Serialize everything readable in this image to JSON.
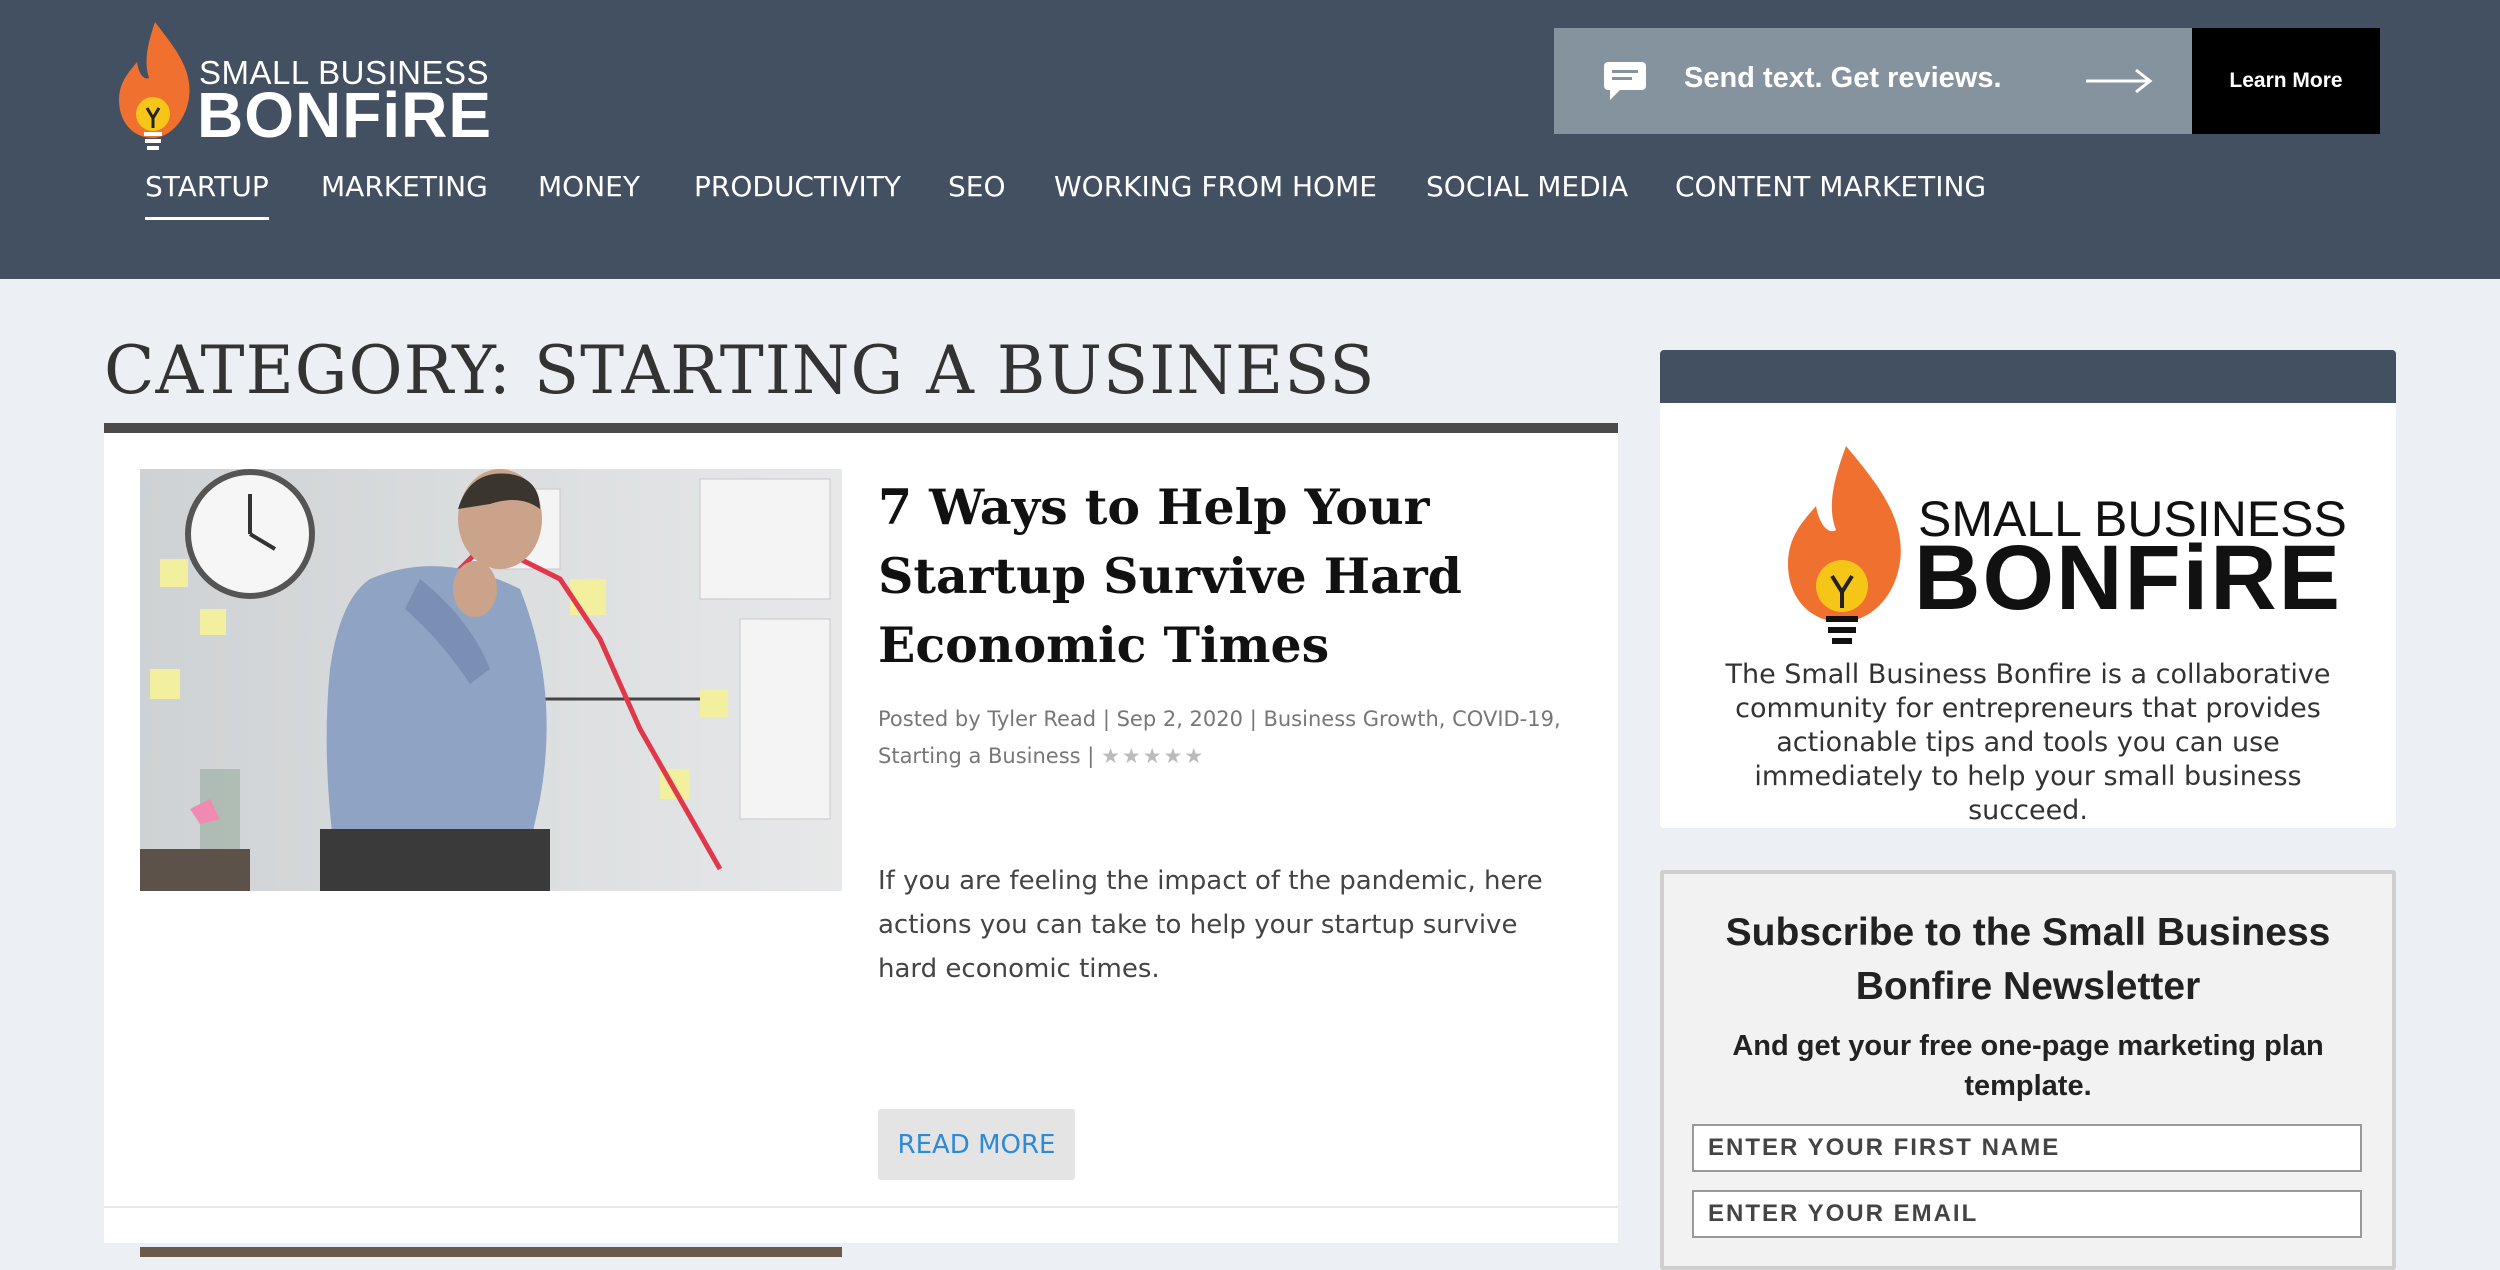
{
  "header": {
    "logo": {
      "line1": "SMALL BUSINESS",
      "line2": "BONFiRE"
    },
    "ad": {
      "text": "Send text. Get reviews.",
      "button_label": "Learn More",
      "icon": "chat-bubble-icon",
      "arrow_icon": "arrow-right-icon"
    },
    "nav": [
      {
        "label": "STARTUP",
        "active": true
      },
      {
        "label": "MARKETING"
      },
      {
        "label": "MONEY"
      },
      {
        "label": "PRODUCTIVITY"
      },
      {
        "label": "SEO"
      },
      {
        "label": "WORKING FROM HOME"
      },
      {
        "label": "SOCIAL MEDIA"
      },
      {
        "label": "CONTENT MARKETING"
      }
    ]
  },
  "main": {
    "category_title": "CATEGORY: STARTING A BUSINESS",
    "post": {
      "title": "7 Ways to Help Your Startup Survive Hard Economic Times",
      "meta": {
        "posted_by_prefix": "Posted by",
        "author": "Tyler Read",
        "date": "Sep 2, 2020",
        "categories": [
          "Business Growth",
          "COVID-19",
          "Starting a Business"
        ],
        "stars": "★★★★★"
      },
      "excerpt": "If you are feeling the impact of the pandemic, here actions you can take to help your startup survive hard economic times.",
      "read_more": "READ MORE"
    }
  },
  "sidebar": {
    "about": {
      "logo": {
        "line1": "SMALL BUSINESS",
        "line2": "BONFiRE"
      },
      "description": "The Small Business Bonfire is a collaborative community for entrepreneurs that provides actionable tips and tools you can use immediately to help your small business succeed."
    },
    "subscribe": {
      "title": "Subscribe to the Small Business Bonfire Newsletter",
      "subtitle": "And get your free one-page marketing plan template.",
      "first_name_placeholder": "ENTER YOUR FIRST NAME",
      "email_placeholder": "ENTER YOUR EMAIL"
    }
  },
  "colors": {
    "header_bg": "#435061",
    "flame_orange": "#f07030",
    "bulb_yellow": "#f5c518",
    "link_blue": "#2e8ad6",
    "page_bg": "#ecf0f5"
  }
}
